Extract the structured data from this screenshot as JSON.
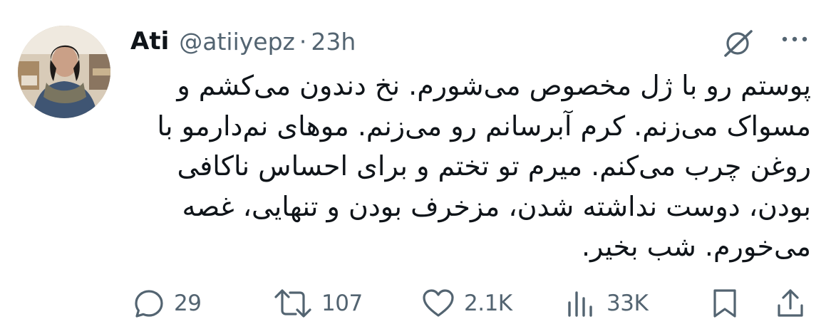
{
  "tweet": {
    "author_name": "Ati",
    "author_handle": "@atiiyepz",
    "separator": "·",
    "time_ago": "23h",
    "text": "پوستم رو با ژل مخصوص می‌شورم. نخ دندون می‌کشم و مسواک می‌زنم. کرم آبرسانم رو می‌زنم. موهای نم‌دارمو با روغن چرب می‌کنم. میرم تو تختم و برای احساس ناکافی بودن، دوست نداشته شدن، مزخرف بودن و تنهایی، غصه می‌خورم. شب بخیر."
  },
  "actions": {
    "reply_count": "29",
    "retweet_count": "107",
    "like_count": "2.1K",
    "views_count": "33K"
  },
  "icons": {
    "grok": "grok-icon",
    "more": "more-dots-icon",
    "reply": "reply-bubble-icon",
    "retweet": "retweet-icon",
    "like": "heart-icon",
    "views": "views-bars-icon",
    "bookmark": "bookmark-icon",
    "share": "share-icon"
  },
  "colors": {
    "text_primary": "#0f1419",
    "text_secondary": "#536471",
    "background": "#ffffff"
  }
}
